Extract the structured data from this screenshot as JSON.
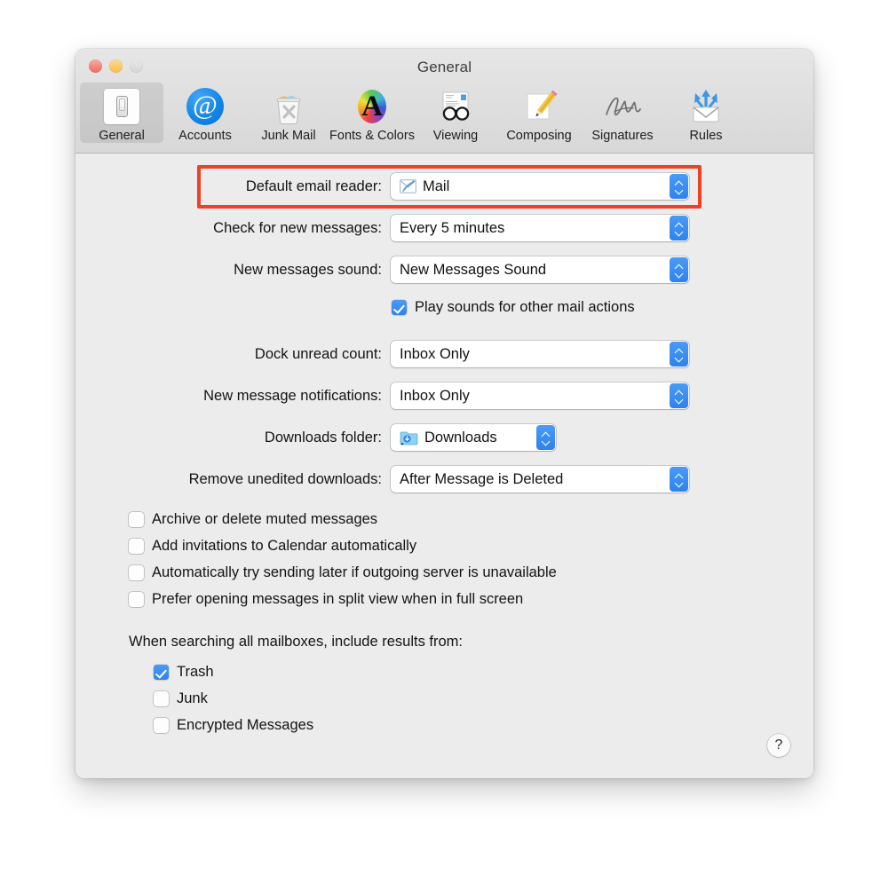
{
  "window": {
    "title": "General",
    "traffic_lights": [
      {
        "name": "close",
        "color": "#f1685e"
      },
      {
        "name": "minimize",
        "color": "#fbbe3f"
      },
      {
        "name": "zoom",
        "color": "#d5d5d5"
      }
    ]
  },
  "toolbar": {
    "items": [
      {
        "label": "General",
        "icon": "switch-icon",
        "selected": true
      },
      {
        "label": "Accounts",
        "icon": "at-sign-icon",
        "selected": false
      },
      {
        "label": "Junk Mail",
        "icon": "trash-can-icon",
        "selected": false
      },
      {
        "label": "Fonts & Colors",
        "icon": "color-wheel-a-icon",
        "selected": false
      },
      {
        "label": "Viewing",
        "icon": "glasses-icon",
        "selected": false
      },
      {
        "label": "Composing",
        "icon": "pencil-paper-icon",
        "selected": false
      },
      {
        "label": "Signatures",
        "icon": "signature-icon",
        "selected": false
      },
      {
        "label": "Rules",
        "icon": "envelope-arrows-icon",
        "selected": false
      }
    ]
  },
  "settings": {
    "default_email_reader": {
      "label": "Default email reader:",
      "value": "Mail",
      "icon": "mail-app-icon",
      "highlighted": true
    },
    "check_for_new_messages": {
      "label": "Check for new messages:",
      "value": "Every 5 minutes"
    },
    "new_messages_sound": {
      "label": "New messages sound:",
      "value": "New Messages Sound"
    },
    "play_sounds": {
      "label": "Play sounds for other mail actions",
      "checked": true
    },
    "dock_unread_count": {
      "label": "Dock unread count:",
      "value": "Inbox Only"
    },
    "new_message_notifications": {
      "label": "New message notifications:",
      "value": "Inbox Only"
    },
    "downloads_folder": {
      "label": "Downloads folder:",
      "value": "Downloads",
      "icon": "downloads-folder-icon"
    },
    "remove_unedited_downloads": {
      "label": "Remove unedited downloads:",
      "value": "After Message is Deleted"
    }
  },
  "checkboxes": [
    {
      "label": "Archive or delete muted messages",
      "checked": false
    },
    {
      "label": "Add invitations to Calendar automatically",
      "checked": false
    },
    {
      "label": "Automatically try sending later if outgoing server is unavailable",
      "checked": false
    },
    {
      "label": "Prefer opening messages in split view when in full screen",
      "checked": false
    }
  ],
  "search_section": {
    "heading": "When searching all mailboxes, include results from:",
    "options": [
      {
        "label": "Trash",
        "checked": true
      },
      {
        "label": "Junk",
        "checked": false
      },
      {
        "label": "Encrypted Messages",
        "checked": false
      }
    ]
  },
  "help_button": {
    "label": "?"
  },
  "colors": {
    "accent": "#2e82ef",
    "annotation": "#ef4123",
    "window_bg": "#ececec",
    "chrome_bg": "#dedede"
  }
}
